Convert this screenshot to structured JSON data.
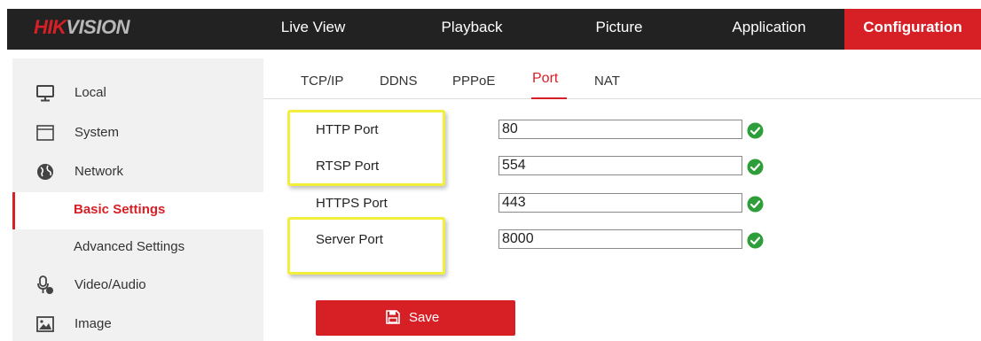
{
  "brand": {
    "part1": "HIK",
    "part2": "VISION"
  },
  "nav": {
    "live_view": "Live View",
    "playback": "Playback",
    "picture": "Picture",
    "application": "Application",
    "configuration": "Configuration"
  },
  "sidebar": {
    "local": "Local",
    "system": "System",
    "network": "Network",
    "basic_settings": "Basic Settings",
    "advanced_settings": "Advanced Settings",
    "video_audio": "Video/Audio",
    "image": "Image"
  },
  "tabs": {
    "tcpip": "TCP/IP",
    "ddns": "DDNS",
    "pppoe": "PPPoE",
    "port": "Port",
    "nat": "NAT"
  },
  "form": {
    "http_label": "HTTP Port",
    "http_value": "80",
    "rtsp_label": "RTSP Port",
    "rtsp_value": "554",
    "https_label": "HTTPS Port",
    "https_value": "443",
    "server_label": "Server Port",
    "server_value": "8000"
  },
  "save_label": "Save",
  "colors": {
    "accent": "#d71f26",
    "topbar": "#222222",
    "sidebar": "#f1f1f1",
    "highlight": "#f2ee3c",
    "check": "#2e9e3a"
  },
  "icons": [
    "monitor-icon",
    "window-icon",
    "globe-icon",
    "mic-camera-icon",
    "image-icon",
    "check-circle-icon",
    "floppy-disk-icon"
  ]
}
